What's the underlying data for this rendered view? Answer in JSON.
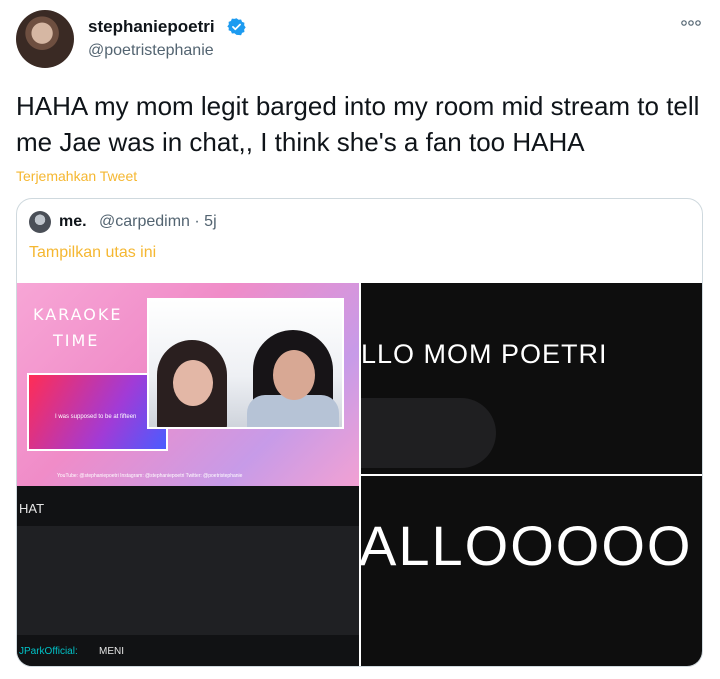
{
  "tweet": {
    "display_name": "stephaniepoetri",
    "handle": "@poetristephanie",
    "text": "HAHA my mom legit barged into my room mid stream to tell me Jae was in chat,, I think she's a fan too HAHA",
    "translate_label": "Terjemahkan Tweet",
    "more_icon": "more-icon",
    "verified_icon": "verified-badge-icon"
  },
  "quoted": {
    "display_name": "me.",
    "handle_time": "@carpedimn · 5j",
    "thread_link": "Tampilkan utas ini"
  },
  "media": {
    "stream_overlay": {
      "title_top": "KARAOKE",
      "title_bottom": "TIME",
      "lyric": "I was supposed to be at fifteen",
      "socials": "YouTube: @stephaniepoetri   Instagram: @stephaniepoetri   Twitter: @poetristephanie",
      "chat_header": "HAT",
      "chat_user": "JParkOfficial:",
      "chat_message": "MENI"
    },
    "image2_text": "LLO MOM POETRI",
    "image3_text": "ALLOOOOO"
  },
  "colors": {
    "accent": "#f5b731",
    "verified": "#1d9bf0",
    "text_secondary": "#536471"
  }
}
